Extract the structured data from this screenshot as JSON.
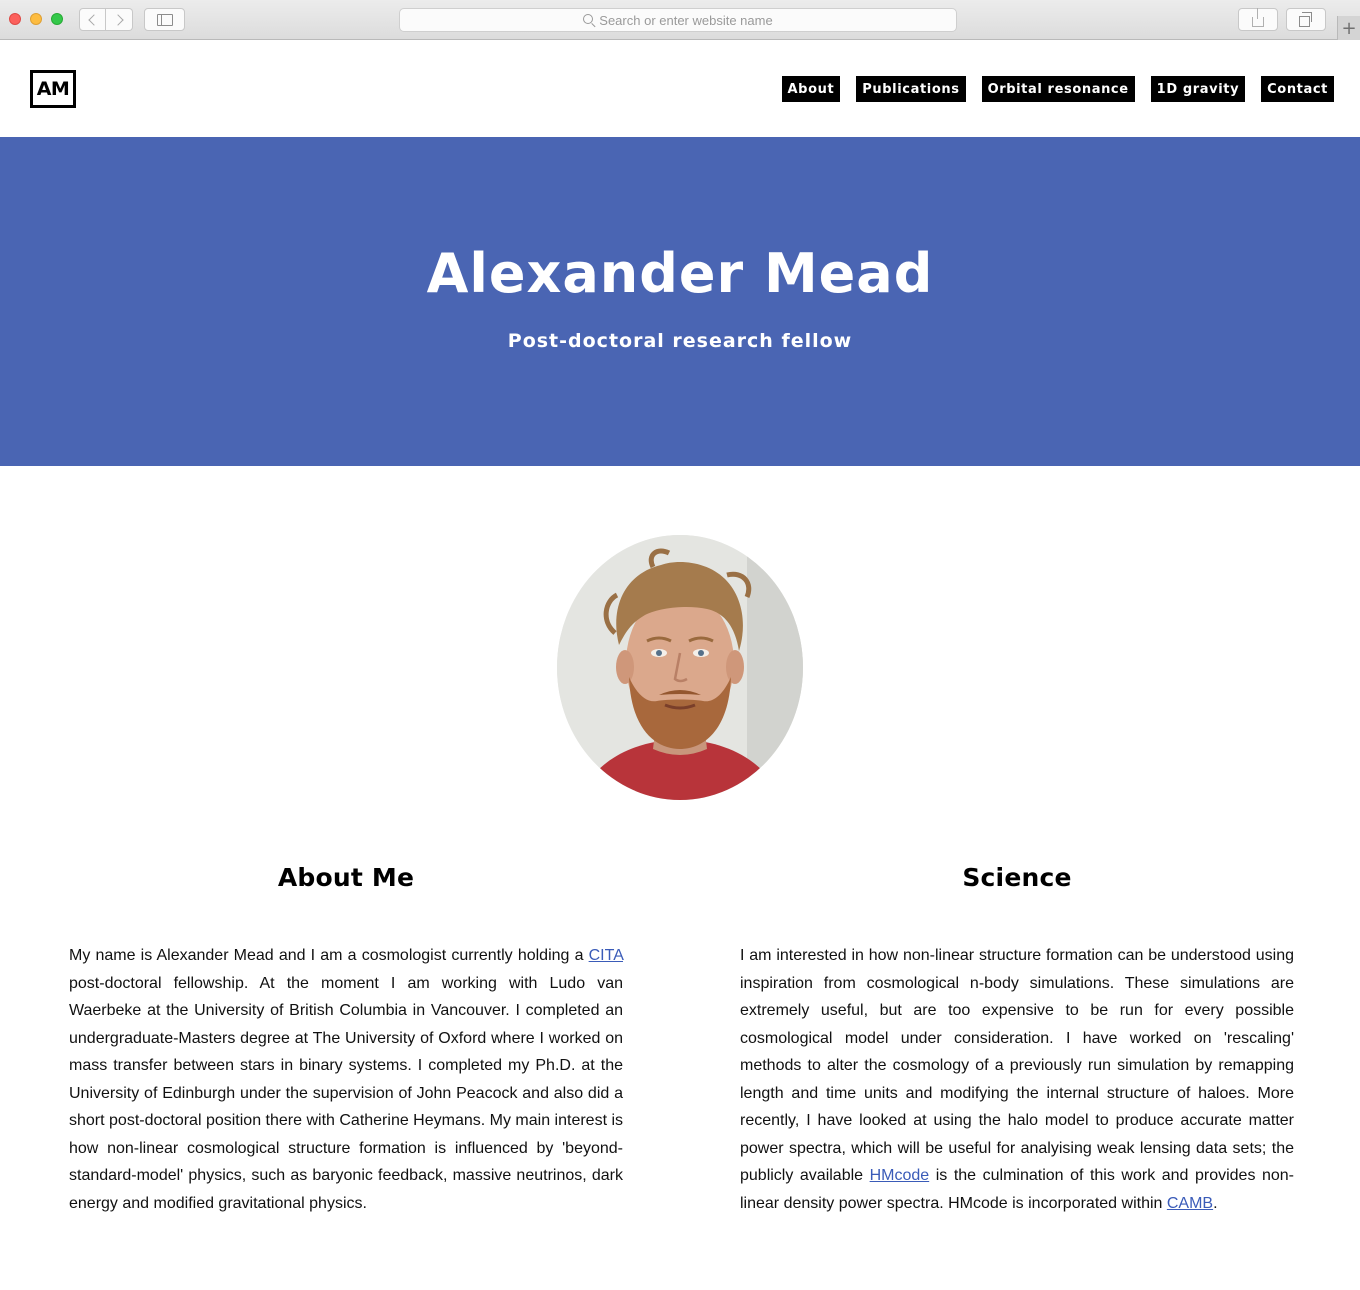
{
  "browser": {
    "address_placeholder": "Search or enter website name",
    "new_tab_symbol": "+"
  },
  "site": {
    "logo_text": "AM",
    "nav": [
      "About",
      "Publications",
      "Orbital resonance",
      "1D gravity",
      "Contact"
    ]
  },
  "hero": {
    "title": "Alexander Mead",
    "subtitle": "Post-doctoral research fellow",
    "background_color": "#4a65b3"
  },
  "about": {
    "heading": "About Me",
    "text_before_link": "My name is Alexander Mead and I am a cosmologist currently holding a ",
    "link_text": "CITA",
    "text_after_link": " post-doctoral fellowship. At the moment I am working with Ludo van Waerbeke at the University of British Columbia in Vancouver. I completed an undergraduate-Masters degree at The University of Oxford where I worked on mass transfer between stars in binary systems. I completed my Ph.D. at the University of Edinburgh under the supervision of John Peacock and also did a short post-doctoral position there with Catherine Heymans. My main interest is how non-linear cosmological structure formation is influenced by 'beyond-standard-model' physics, such as baryonic feedback, massive neutrinos, dark energy and modified gravitational physics."
  },
  "science": {
    "heading": "Science",
    "text_before_link1": "I am interested in how non-linear structure formation can be understood using inspiration from cosmological n-body simulations. These simulations are extremely useful, but are too expensive to be run for every possible cosmological model under consideration. I have worked on 'rescaling' methods to alter the cosmology of a previously run simulation by remapping length and time units and modifying the internal structure of haloes. More recently, I have looked at using the halo model to produce accurate matter power spectra, which will be useful for analyising weak lensing data sets; the publicly available ",
    "link1_text": "HMcode",
    "text_between_links": " is the culmination of this work and provides non-linear density power spectra. HMcode is incorporated within ",
    "link2_text": "CAMB",
    "text_after_link2": "."
  },
  "colors": {
    "link": "#3a5bb8",
    "nav_background": "#000000"
  }
}
